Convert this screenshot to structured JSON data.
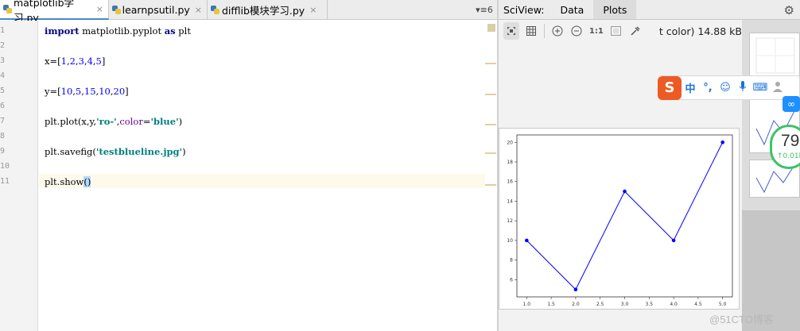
{
  "editor": {
    "tabs": [
      {
        "label": "matplotlib学习.py",
        "close": "×",
        "active": true
      },
      {
        "label": "learnpsutil.py",
        "close": "×",
        "active": false
      },
      {
        "label": "difflib模块学习.py",
        "close": "×",
        "active": false
      }
    ],
    "tab_overflow": "▾≡6",
    "line_numbers": [
      "1",
      "2",
      "3",
      "4",
      "5",
      "6",
      "7",
      "8",
      "9",
      "10",
      "11"
    ],
    "code": {
      "l1_kw_import": "import",
      "l1_module": " matplotlib.pyplot ",
      "l1_kw_as": "as",
      "l1_alias": " plt",
      "l3_a": "x=[",
      "l3_n1": "1",
      "l3_c1": ",",
      "l3_n2": "2",
      "l3_c2": ",",
      "l3_n3": "3",
      "l3_c3": ",",
      "l3_n4": "4",
      "l3_c4": ",",
      "l3_n5": "5",
      "l3_end": "]",
      "l5_a": "y=[",
      "l5_n1": "10",
      "l5_c1": ",",
      "l5_n2": "5",
      "l5_c2": ",",
      "l5_n3": "15",
      "l5_c3": ",",
      "l5_n4": "10",
      "l5_c4": ",",
      "l5_n5": "20",
      "l5_end": "]",
      "l7_a": "plt.plot(x,y,",
      "l7_s1": "'ro-'",
      "l7_b": ",",
      "l7_param": "color",
      "l7_eq": "=",
      "l7_s2": "'blue'",
      "l7_end": ")",
      "l9_a": "plt.savefig(",
      "l9_s": "'testblueline.jpg'",
      "l9_end": ")",
      "l11_a": "plt.show",
      "l11_parens": "()"
    }
  },
  "sciview": {
    "label": "SciView:",
    "tabs": [
      {
        "label": "Data",
        "active": false
      },
      {
        "label": "Plots",
        "active": true
      }
    ],
    "toolbar": {
      "actual_size": "1:1",
      "file_info": "t color) 14.88 kB"
    },
    "icons": [
      "fit-icon",
      "grid-icon",
      "zoom-in-icon",
      "zoom-out-icon",
      "actual-size-icon",
      "background-icon",
      "color-picker-icon",
      "gear-icon"
    ]
  },
  "ime": {
    "logo": "S",
    "mode": "中",
    "punct": "°,",
    "emoji": "☺",
    "mic": "🎤",
    "keyboard": "⌨",
    "user": "👤"
  },
  "net_badge": "∞",
  "speed_widget": {
    "value": "79",
    "sub": "↑0.01k"
  },
  "watermark": "@51CTO博客",
  "chart_data": {
    "type": "line",
    "x": [
      1,
      2,
      3,
      4,
      5
    ],
    "series": [
      {
        "values": [
          10,
          5,
          15,
          10,
          20
        ],
        "color": "#0000ff",
        "marker": "o"
      }
    ],
    "xticks": [
      "1.0",
      "1.5",
      "2.0",
      "2.5",
      "3.0",
      "3.5",
      "4.0",
      "4.5",
      "5.0"
    ],
    "yticks": [
      "6",
      "8",
      "10",
      "12",
      "14",
      "16",
      "18",
      "20"
    ],
    "xlim": [
      0.8,
      5.2
    ],
    "ylim": [
      4.25,
      20.75
    ]
  }
}
